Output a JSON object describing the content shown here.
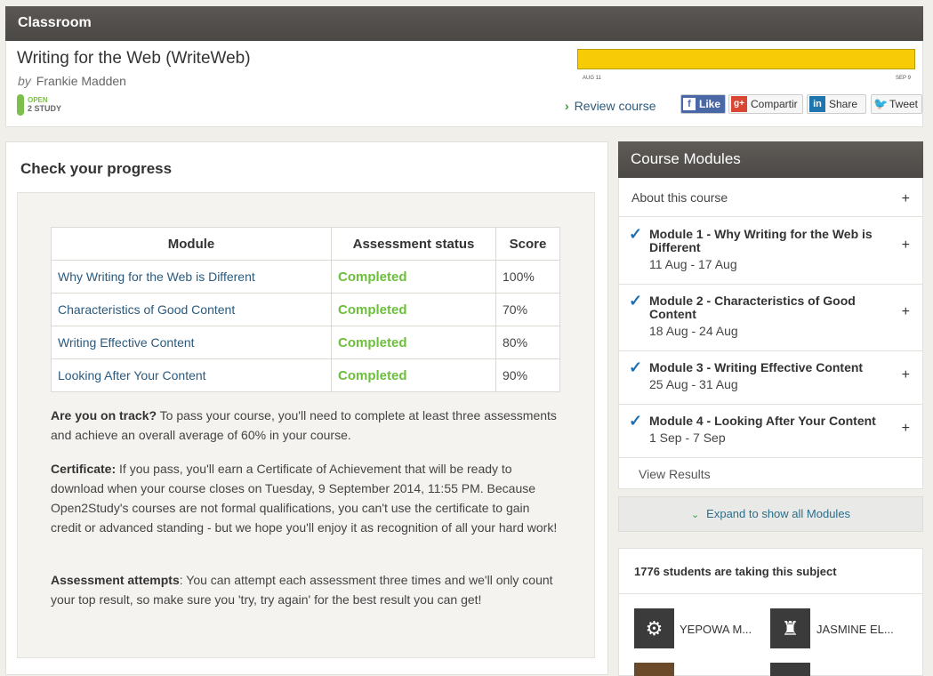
{
  "topbar": {
    "title": "Classroom"
  },
  "course": {
    "title": "Writing for the Web (WriteWeb)",
    "by": "by",
    "author": "Frankie Madden",
    "logo_line1": "OPEN",
    "logo_line2": "2 STUDY",
    "progress_fraction": 1.0,
    "progress_start": "AUG 11",
    "progress_end": "SEP 9",
    "review_label": "Review course"
  },
  "social": {
    "like": "Like",
    "share_google": "Compartir",
    "share_linkedin": "Share",
    "tweet": "Tweet"
  },
  "progress": {
    "heading": "Check your progress",
    "columns": [
      "Module",
      "Assessment status",
      "Score"
    ],
    "rows": [
      {
        "module": "Why Writing for the Web is Different",
        "status": "Completed",
        "score": "100%"
      },
      {
        "module": "Characteristics of Good Content",
        "status": "Completed",
        "score": "70%"
      },
      {
        "module": "Writing Effective Content",
        "status": "Completed",
        "score": "80%"
      },
      {
        "module": "Looking After Your Content",
        "status": "Completed",
        "score": "90%"
      }
    ],
    "ontrack_label": "Are you on track?",
    "ontrack_text": " To pass your course, you'll need to complete at least three assessments and achieve an overall average of 60% in your course.",
    "certificate_label": "Certificate:",
    "certificate_text": " If you pass, you'll earn a Certificate of Achievement that will be ready to download when your course closes on Tuesday, 9 September 2014, 11:55 PM. Because Open2Study's courses are not formal qualifications, you can't use the certificate to gain credit or advanced standing - but we hope you'll enjoy it as recognition of all your hard work!",
    "attempts_label": "Assessment attempts",
    "attempts_text": ": You can attempt each assessment three times and we'll only count your top result, so make sure you 'try, try again' for the best result you can get!"
  },
  "modules": {
    "heading": "Course Modules",
    "about": "About this course",
    "items": [
      {
        "name": "Module 1 - Why Writing for the Web is Different",
        "dates": "11 Aug - 17 Aug"
      },
      {
        "name": "Module 2 - Characteristics of Good Content",
        "dates": "18 Aug - 24 Aug"
      },
      {
        "name": "Module 3 - Writing Effective Content",
        "dates": "25 Aug - 31 Aug"
      },
      {
        "name": "Module 4 - Looking After Your Content",
        "dates": "1 Sep - 7 Sep"
      }
    ],
    "view_results": "View Results",
    "expand": "Expand to show all Modules"
  },
  "students": {
    "heading": "1776 students are taking this subject",
    "list": [
      "YEPOWA M...",
      "JASMINE EL..."
    ]
  },
  "icons": {
    "check": "check-icon",
    "plus": "plus-icon",
    "chevron": "chevron-icon"
  },
  "colors": {
    "accent": "#f7cc07",
    "completed": "#6cbf3a",
    "link": "#2b5a7d",
    "check": "#1f6fb0"
  }
}
